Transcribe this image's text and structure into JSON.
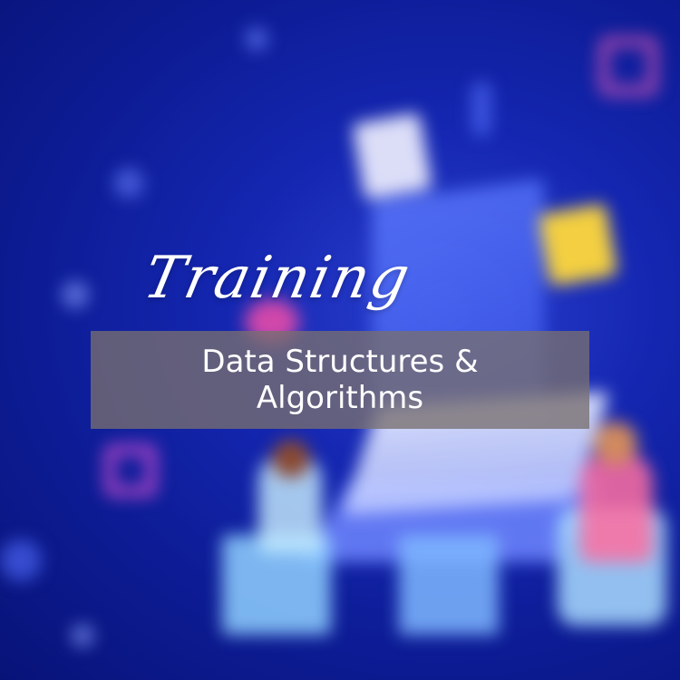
{
  "title": "Training",
  "subtitle_lines": [
    "Data Structures &",
    "Algorithms"
  ],
  "colors": {
    "background": "#1426b0",
    "banner": "#787070",
    "text": "#ffffff",
    "accent_yellow": "#ffd83a",
    "accent_pink": "#ff5fb7"
  },
  "illustration": {
    "description_icon": "isometric-developers-workstation-illustration"
  }
}
